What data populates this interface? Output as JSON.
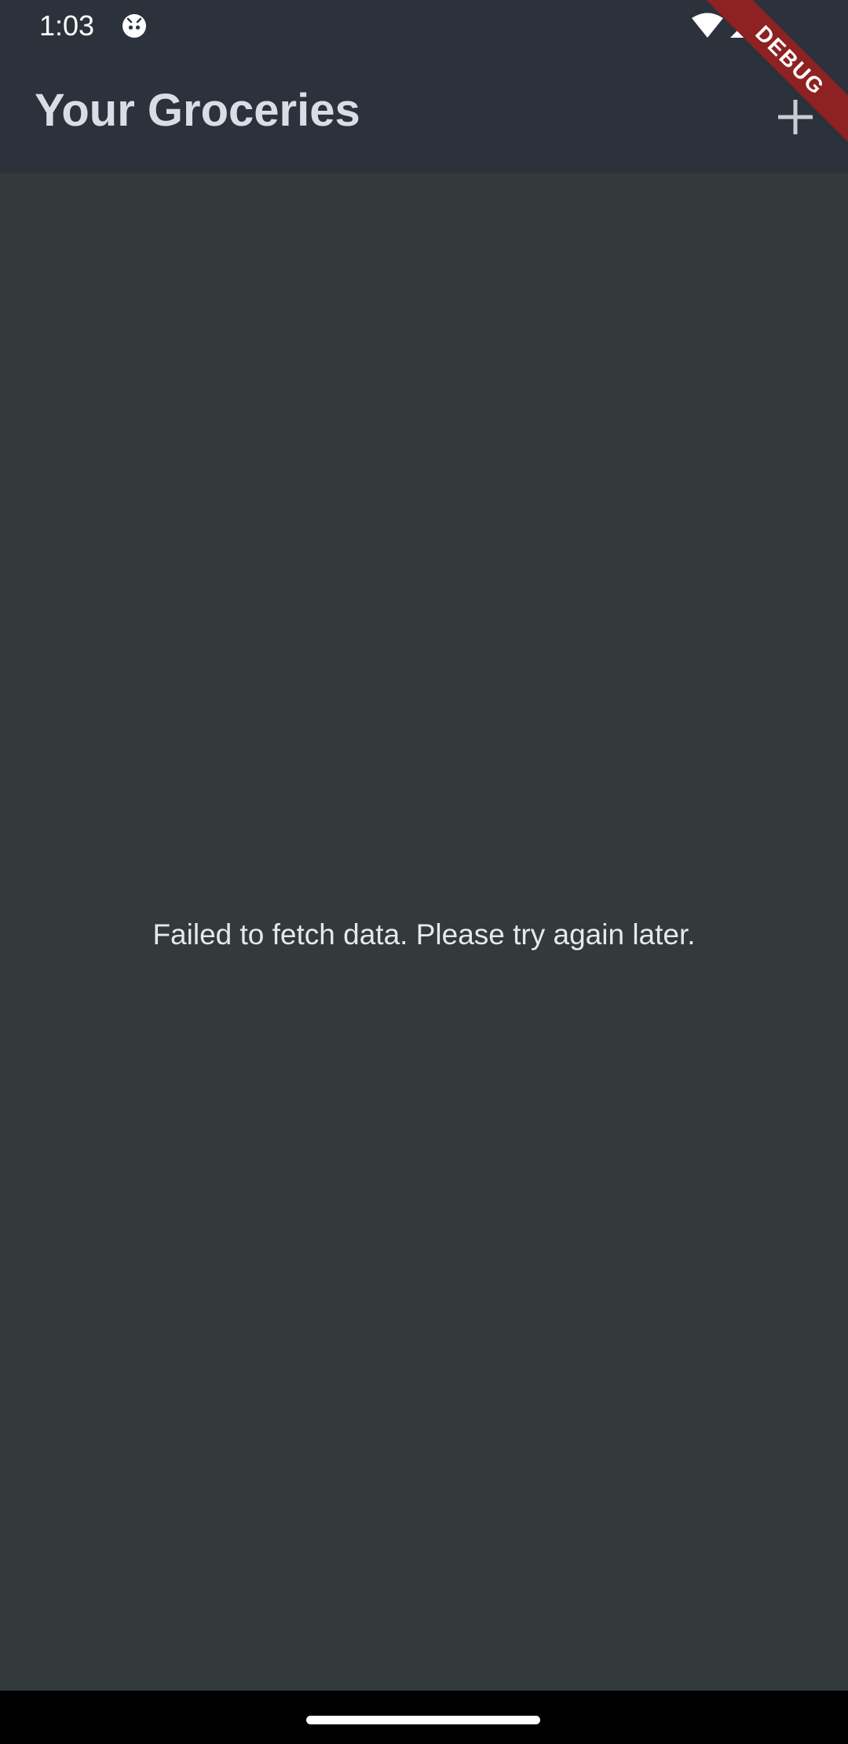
{
  "status_bar": {
    "time": "1:03",
    "app_icon": "android-robot-icon",
    "wifi_icon": "wifi-icon",
    "signal_icon": "cell-signal-icon"
  },
  "app_bar": {
    "title": "Your Groceries",
    "add_icon": "plus-icon"
  },
  "debug_banner": {
    "label": "DEBUG"
  },
  "main": {
    "error_message": "Failed to fetch data. Please try again later."
  },
  "colors": {
    "app_bar_background": "#2b323b",
    "body_background": "#323a3c",
    "title_text": "#d8dee6",
    "debug_banner": "#8e2121",
    "nav_bar": "#000000"
  }
}
